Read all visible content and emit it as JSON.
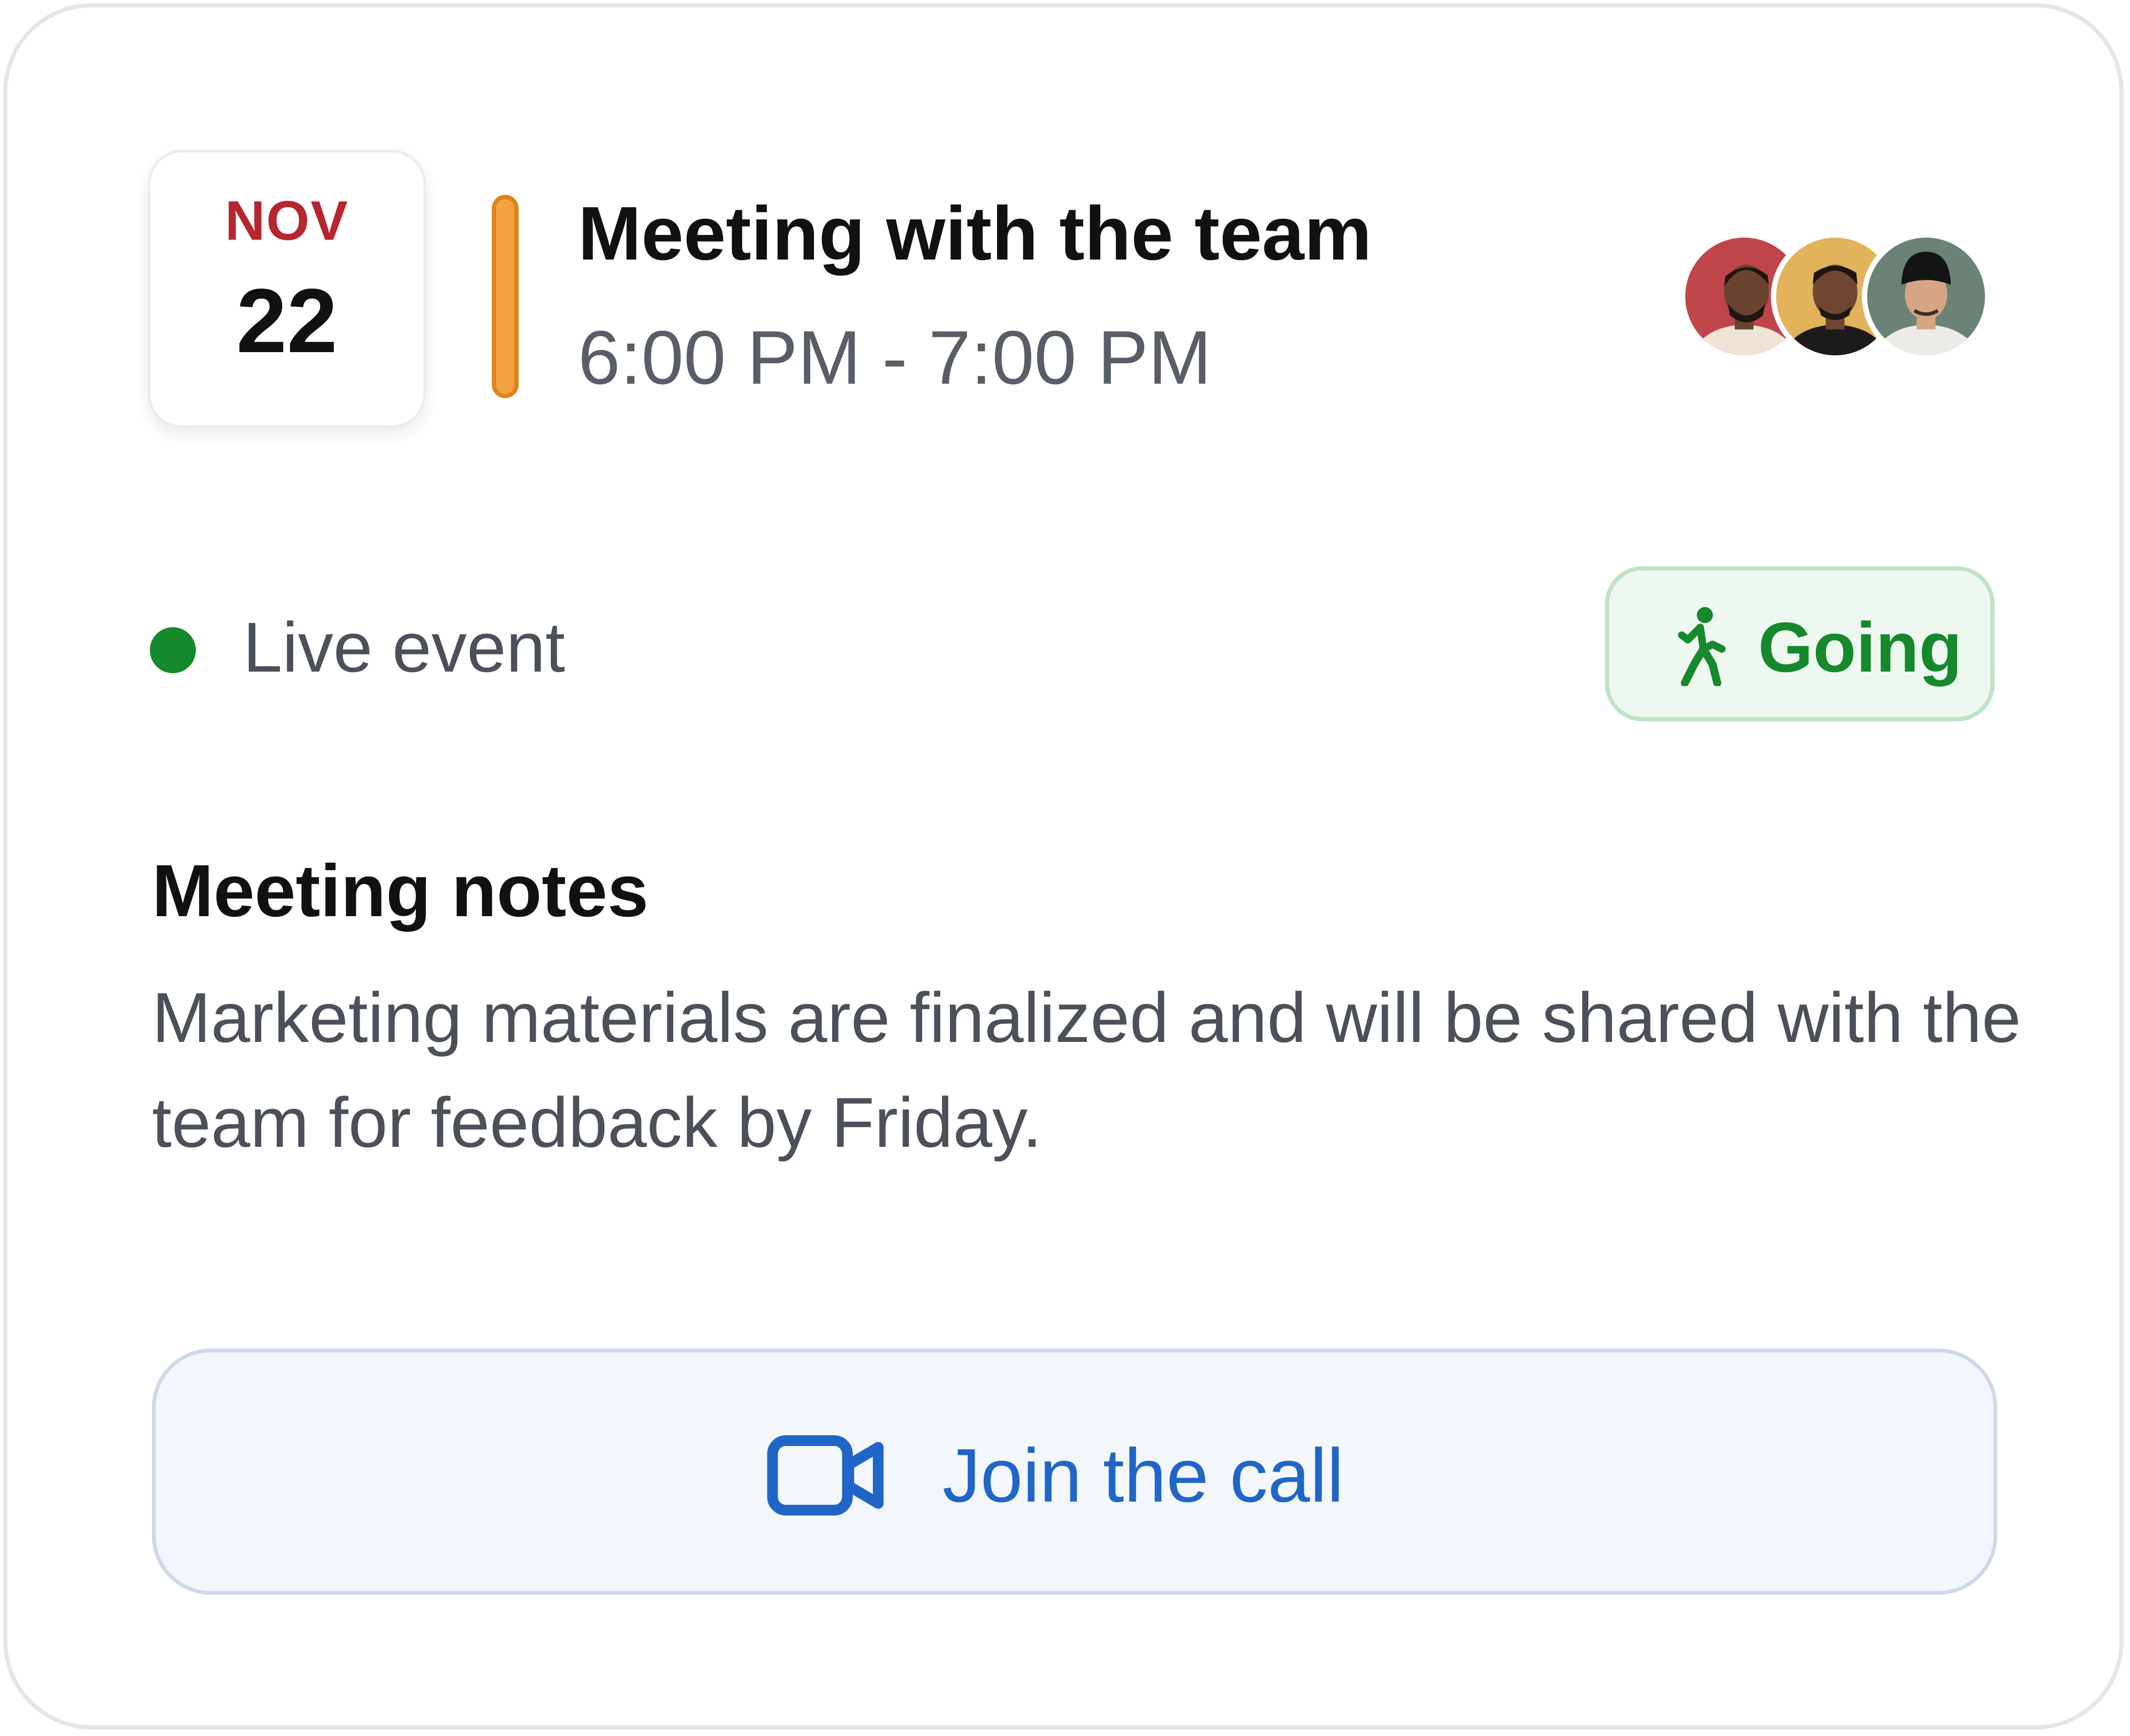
{
  "event": {
    "month": "NOV",
    "day": "22",
    "title": "Meeting with the team",
    "time": "6:00 PM - 7:00 PM",
    "accent_color": "#f2a341"
  },
  "attendees": [
    {
      "icon": "avatar-icon",
      "bg": "#c0454b"
    },
    {
      "icon": "avatar-icon",
      "bg": "#e2b35a"
    },
    {
      "icon": "avatar-icon",
      "bg": "#6b8276"
    }
  ],
  "status": {
    "live_label": "Live event",
    "live_color": "#15892b",
    "rsvp_label": "Going",
    "rsvp_icon": "walking-person-icon"
  },
  "notes": {
    "heading": "Meeting notes",
    "body": "Marketing materials are finalized and will be shared with the team for feedback by Friday."
  },
  "call": {
    "label": "Join the call",
    "icon": "video-camera-icon",
    "color": "#1f66c8"
  }
}
